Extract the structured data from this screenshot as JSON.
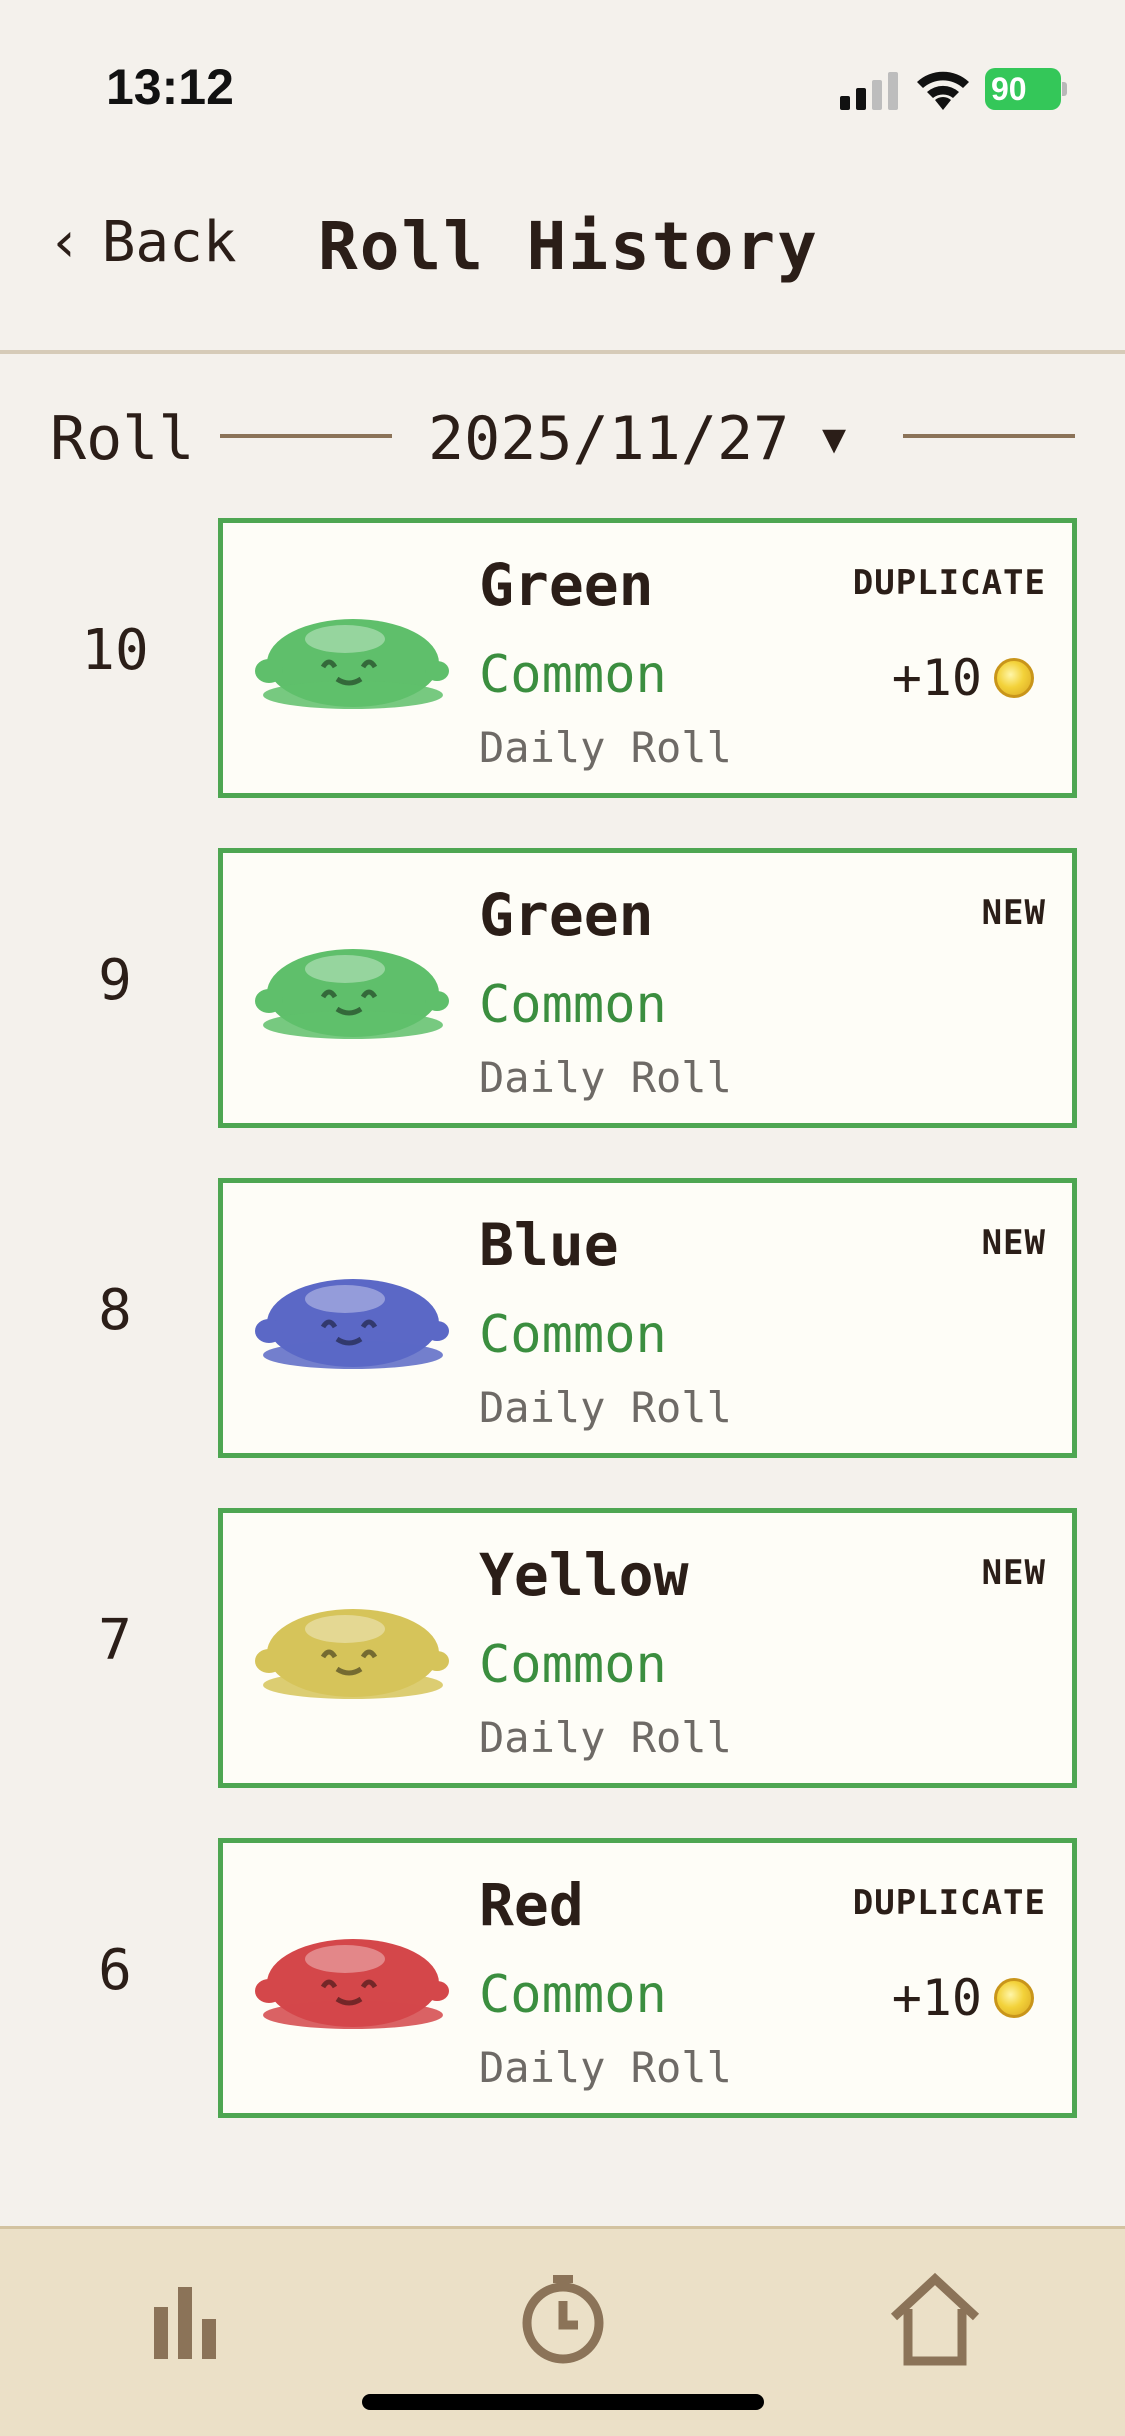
{
  "status_bar": {
    "time": "13:12",
    "battery": "90"
  },
  "header": {
    "back_label": "Back",
    "title": "Roll History"
  },
  "filter": {
    "roll_label": "Roll",
    "date": "2025/11/27",
    "caret": "▼"
  },
  "rolls": [
    {
      "number": "10",
      "name": "Green",
      "rarity": "Common",
      "source": "Daily Roll",
      "status": "DUPLICATE",
      "reward": "+10",
      "color": "#5fbf6b"
    },
    {
      "number": "9",
      "name": "Green",
      "rarity": "Common",
      "source": "Daily Roll",
      "status": "NEW",
      "reward": "",
      "color": "#5fbf6b"
    },
    {
      "number": "8",
      "name": "Blue",
      "rarity": "Common",
      "source": "Daily Roll",
      "status": "NEW",
      "reward": "",
      "color": "#5b68c6"
    },
    {
      "number": "7",
      "name": "Yellow",
      "rarity": "Common",
      "source": "Daily Roll",
      "status": "NEW",
      "reward": "",
      "color": "#d6c45a"
    },
    {
      "number": "6",
      "name": "Red",
      "rarity": "Common",
      "source": "Daily Roll",
      "status": "DUPLICATE",
      "reward": "+10",
      "color": "#d4474a"
    }
  ],
  "tab_bar": {
    "items": [
      {
        "icon": "bar-chart-icon"
      },
      {
        "icon": "clock-icon"
      },
      {
        "icon": "home-icon"
      }
    ]
  },
  "colors": {
    "accent_green": "#4ea652",
    "rarity_green": "#3b8e3f",
    "background": "#f4f1ec",
    "tab_bar": "#ebe0c7"
  }
}
